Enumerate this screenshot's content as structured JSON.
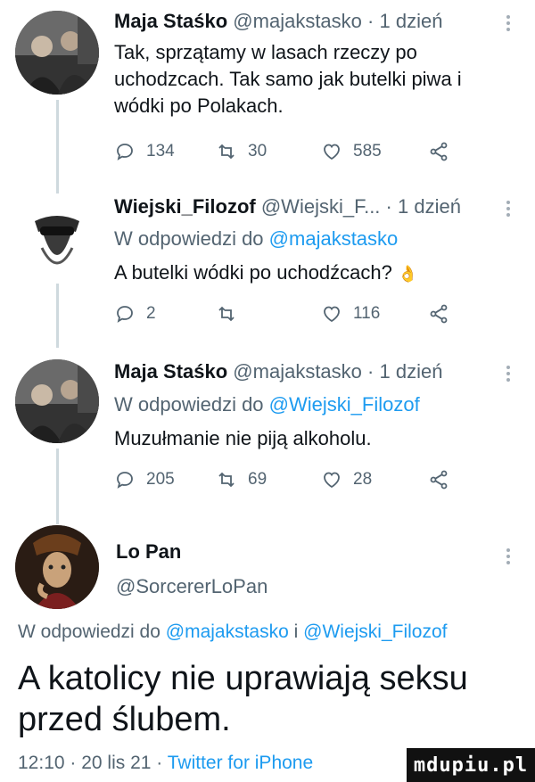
{
  "tweets": [
    {
      "name": "Maja Staśko",
      "handle": "@majakstasko",
      "time": "1 dzień",
      "text": "Tak, sprzątamy w lasach rzeczy po uchodzcach. Tak samo jak butelki piwa i wódki po Polakach.",
      "replies": "134",
      "retweets": "30",
      "likes": "585"
    },
    {
      "name": "Wiejski_Filozof",
      "handle": "@Wiejski_F...",
      "time": "1 dzień",
      "reply_prefix": "W odpowiedzi do",
      "reply_mention": "@majakstasko",
      "text": "A butelki wódki po uchodźcach?",
      "emoji": "👌",
      "replies": "2",
      "retweets": "",
      "likes": "116"
    },
    {
      "name": "Maja Staśko",
      "handle": "@majakstasko",
      "time": "1 dzień",
      "reply_prefix": "W odpowiedzi do",
      "reply_mention": "@Wiejski_Filozof",
      "text": "Muzułmanie nie piją alkoholu.",
      "replies": "205",
      "retweets": "69",
      "likes": "28"
    }
  ],
  "main": {
    "name": "Lo Pan",
    "handle": "@SorcererLoPan",
    "reply_prefix": "W odpowiedzi do",
    "mention1": "@majakstasko",
    "conj": "i",
    "mention2": "@Wiejski_Filozof",
    "text": "A katolicy nie uprawiają seksu przed ślubem.",
    "time": "12:10",
    "date": "20 lis 21",
    "client": "Twitter for iPhone"
  },
  "watermark": "mdupiu.pl",
  "colors": {
    "accent": "#1d9bf0",
    "muted": "#536471",
    "text": "#0f1419"
  }
}
